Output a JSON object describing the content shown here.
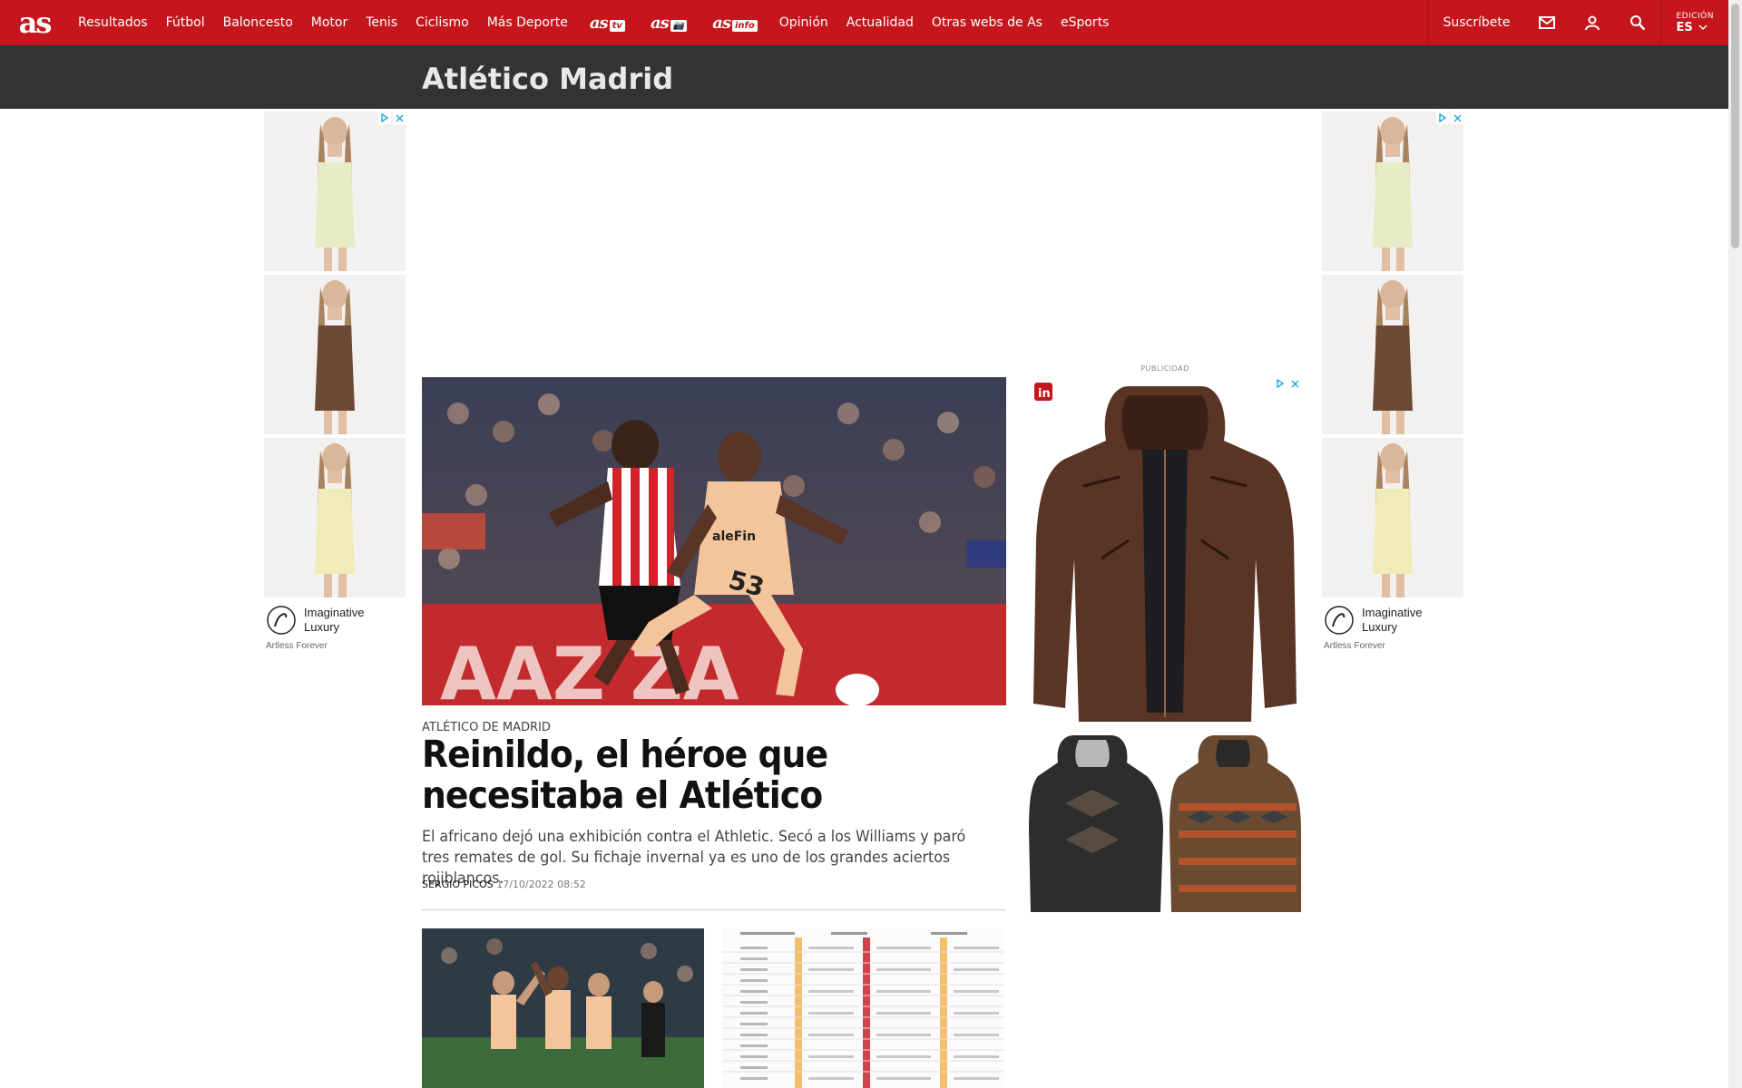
{
  "nav": {
    "logo": "as",
    "items": [
      "Resultados",
      "Fútbol",
      "Baloncesto",
      "Motor",
      "Tenis",
      "Ciclismo",
      "Más Deporte"
    ],
    "brands": [
      {
        "name": "as",
        "tag": "tv"
      },
      {
        "name": "as",
        "tag": "📷"
      },
      {
        "name": "as",
        "tag": "info"
      }
    ],
    "items2": [
      "Opinión",
      "Actualidad",
      "Otras webs de As",
      "eSports"
    ],
    "subscribe": "Suscríbete",
    "edition_label": "EDICIÓN",
    "edition_value": "ES",
    "icons": [
      "mail-icon",
      "user-icon",
      "search-icon",
      "chevron-down-icon"
    ]
  },
  "section": {
    "title": "Atlético Madrid"
  },
  "side_ads": {
    "brand": "Imaginative\nLuxury",
    "brand_line1": "Imaginative",
    "brand_line2": "Luxury",
    "sub": "Artless Forever",
    "dress_colors": [
      "#e6edc6",
      "#6b4a35",
      "#f0ecb8"
    ]
  },
  "article": {
    "kicker": "ATLÉTICO DE MADRID",
    "headline": "Reinildo, el héroe que necesitaba el Atlético",
    "standfirst": "El africano dejó una exhibición contra el Athletic. Secó a los Williams y paró tres remates de gol. Su fichaje invernal ya es uno de los grandes aciertos rojiblancos.",
    "author": "SERGIO PICOS",
    "date": "17/10/2022",
    "time": "08:52"
  },
  "right_ad": {
    "label": "PUBLICIDAD",
    "colors": {
      "brown_jacket": "#5a3424",
      "black_jacket": "#2d2d2d",
      "pattern_jacket": "#6a4a30"
    }
  },
  "colors": {
    "brand_red": "#c4161c",
    "section_bar": "#333333"
  }
}
